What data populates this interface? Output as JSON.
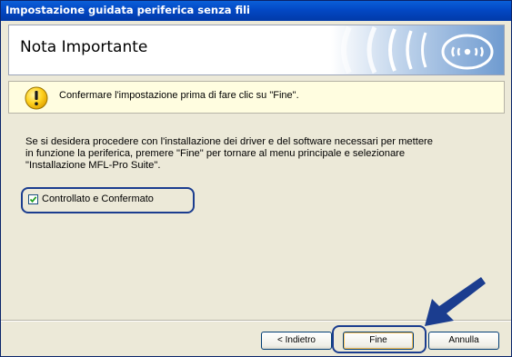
{
  "window": {
    "title": "Impostazione guidata periferica senza fili"
  },
  "header": {
    "title": "Nota Importante",
    "logo_icon": "wireless-signal-icon"
  },
  "notice": {
    "icon": "warning-icon",
    "text": "Confermare l'impostazione prima di fare clic su \"Fine\"."
  },
  "body": {
    "line1": "Se si desidera procedere con l'installazione dei driver e del software necessari per mettere",
    "line2": "in funzione la periferica, premere \"Fine\" per tornare al menu principale e selezionare",
    "line3": "\"Installazione MFL-Pro Suite\"."
  },
  "checkbox": {
    "label": "Controllato e Confermato",
    "checked": true
  },
  "buttons": {
    "back": "< Indietro",
    "finish": "Fine",
    "cancel": "Annulla"
  },
  "colors": {
    "title_bar": "#0348c4",
    "highlight": "#1b3d8f",
    "warning_yellow": "#ffd21f"
  }
}
